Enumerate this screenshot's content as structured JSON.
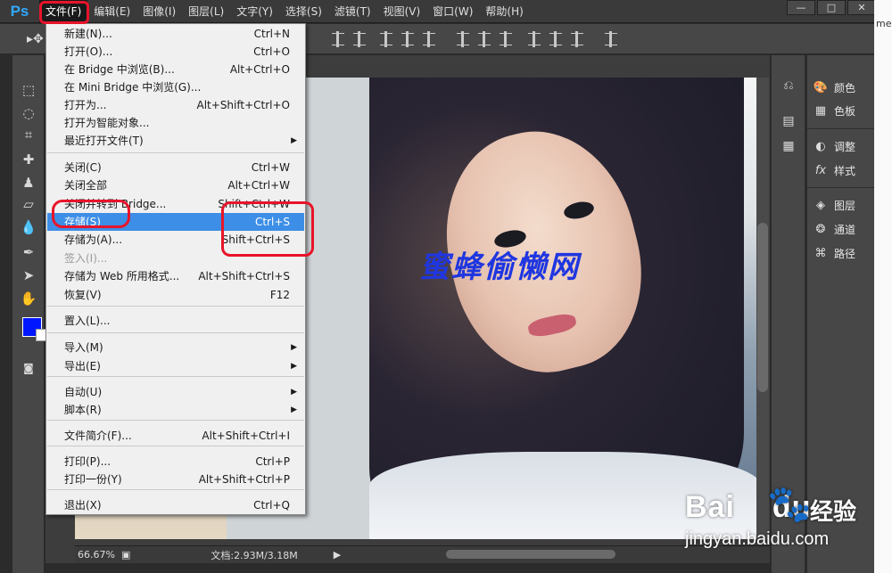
{
  "app": {
    "logo": "Ps"
  },
  "menubar": {
    "items": [
      "文件(F)",
      "编辑(E)",
      "图像(I)",
      "图层(L)",
      "文字(Y)",
      "选择(S)",
      "滤镜(T)",
      "视图(V)",
      "窗口(W)",
      "帮助(H)"
    ],
    "active_index": 0
  },
  "window_controls": {
    "minimize": "—",
    "maximize": "□",
    "close": "✕"
  },
  "file_menu": {
    "items": [
      {
        "label": "新建(N)...",
        "shortcut": "Ctrl+N"
      },
      {
        "label": "打开(O)...",
        "shortcut": "Ctrl+O"
      },
      {
        "label": "在 Bridge 中浏览(B)...",
        "shortcut": "Alt+Ctrl+O"
      },
      {
        "label": "在 Mini Bridge 中浏览(G)...",
        "shortcut": ""
      },
      {
        "label": "打开为...",
        "shortcut": "Alt+Shift+Ctrl+O"
      },
      {
        "label": "打开为智能对象...",
        "shortcut": ""
      },
      {
        "label": "最近打开文件(T)",
        "shortcut": "",
        "submenu": true
      },
      {
        "label": "关闭(C)",
        "shortcut": "Ctrl+W"
      },
      {
        "label": "关闭全部",
        "shortcut": "Alt+Ctrl+W"
      },
      {
        "label": "关闭并转到 Bridge...",
        "shortcut": "Shift+Ctrl+W"
      },
      {
        "label": "存储(S)",
        "shortcut": "Ctrl+S",
        "highlighted": true
      },
      {
        "label": "存储为(A)...",
        "shortcut": "Shift+Ctrl+S"
      },
      {
        "label": "签入(I)...",
        "shortcut": "",
        "disabled": true
      },
      {
        "label": "存储为 Web 所用格式...",
        "shortcut": "Alt+Shift+Ctrl+S"
      },
      {
        "label": "恢复(V)",
        "shortcut": "F12"
      },
      {
        "label": "置入(L)...",
        "shortcut": ""
      },
      {
        "label": "导入(M)",
        "shortcut": "",
        "submenu": true
      },
      {
        "label": "导出(E)",
        "shortcut": "",
        "submenu": true
      },
      {
        "label": "自动(U)",
        "shortcut": "",
        "submenu": true
      },
      {
        "label": "脚本(R)",
        "shortcut": "",
        "submenu": true
      },
      {
        "label": "文件简介(F)...",
        "shortcut": "Alt+Shift+Ctrl+I"
      },
      {
        "label": "打印(P)...",
        "shortcut": "Ctrl+P"
      },
      {
        "label": "打印一份(Y)",
        "shortcut": "Alt+Shift+Ctrl+P"
      },
      {
        "label": "退出(X)",
        "shortcut": "Ctrl+Q"
      }
    ]
  },
  "canvas": {
    "overlay_text": "蜜蜂偷懒网"
  },
  "statusbar": {
    "zoom": "66.67%",
    "doc_size": "文档:2.93M/3.18M"
  },
  "panels": {
    "items": [
      {
        "label": "颜色",
        "icon": "color-palette-icon"
      },
      {
        "label": "色板",
        "icon": "swatches-icon"
      },
      {
        "label": "调整",
        "icon": "adjustments-icon"
      },
      {
        "label": "样式",
        "icon": "styles-fx-icon"
      },
      {
        "label": "图层",
        "icon": "layers-icon"
      },
      {
        "label": "通道",
        "icon": "channels-icon"
      },
      {
        "label": "路径",
        "icon": "paths-icon"
      }
    ]
  },
  "colors": {
    "foreground": "#0016ff",
    "background": "#ffffff",
    "highlight": "#3d8ee6",
    "annotation": "#e8142a"
  },
  "watermark": {
    "logo": "Bai",
    "logo2": "du",
    "brand_suffix": "经验",
    "url": "jingyan.baidu.com"
  },
  "right_edge": {
    "text": "meg"
  }
}
